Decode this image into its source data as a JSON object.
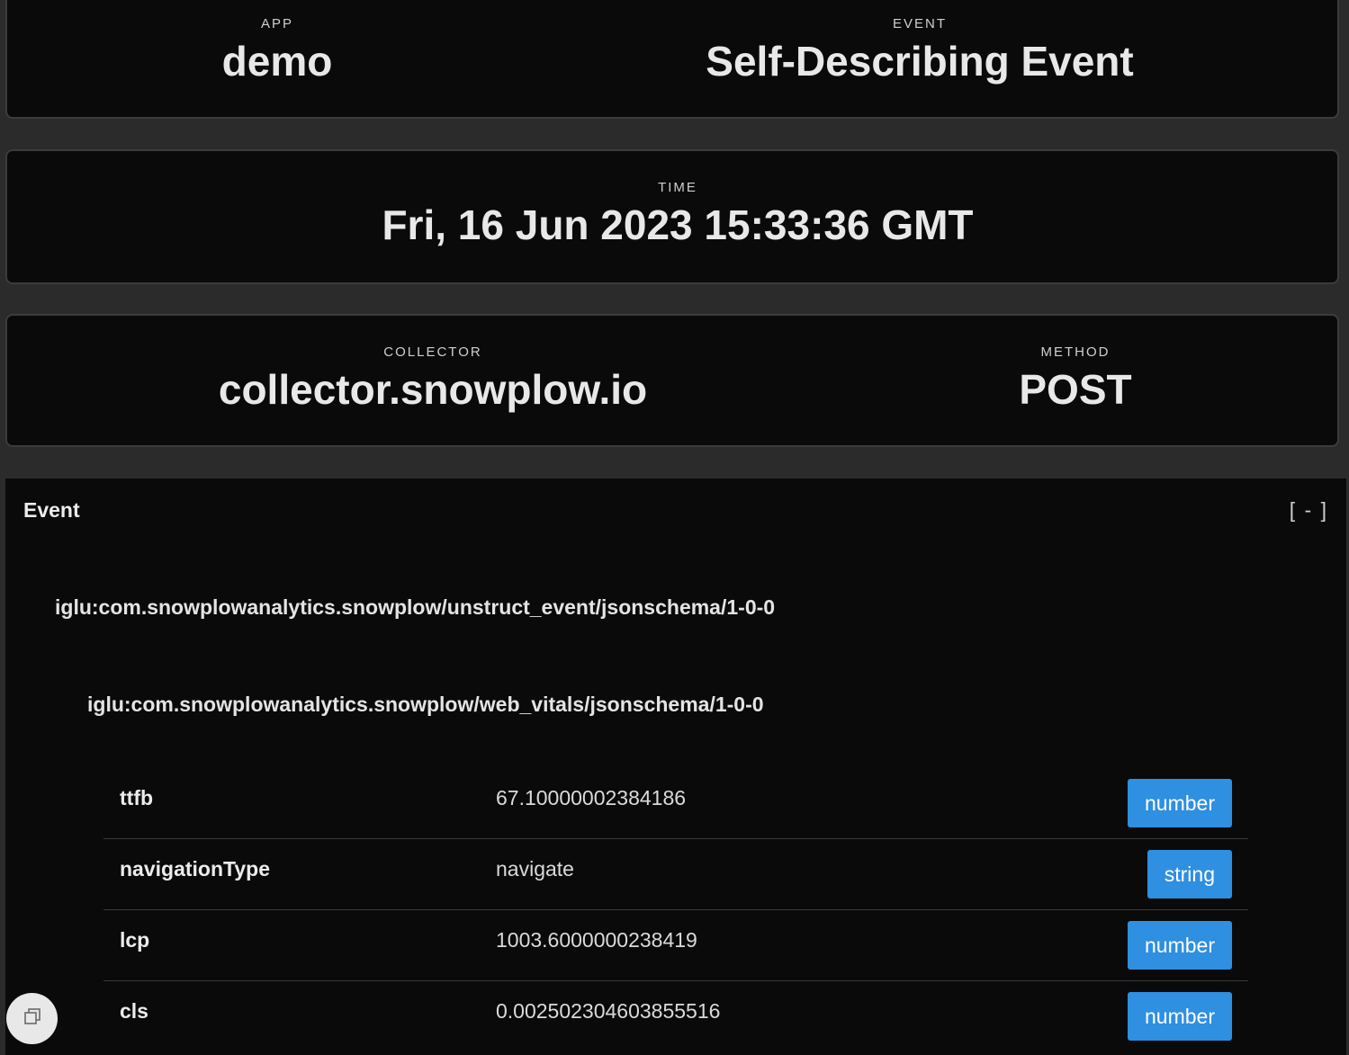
{
  "summary": {
    "app": {
      "label": "APP",
      "value": "demo"
    },
    "event": {
      "label": "EVENT",
      "value": "Self-Describing Event"
    },
    "time": {
      "label": "TIME",
      "value": "Fri, 16 Jun 2023 15:33:36 GMT"
    },
    "collector": {
      "label": "COLLECTOR",
      "value": "collector.snowplow.io"
    },
    "method": {
      "label": "METHOD",
      "value": "POST"
    }
  },
  "event_panel": {
    "title": "Event",
    "toggle": "[ - ]",
    "outer_schema": "iglu:com.snowplowanalytics.snowplow/unstruct_event/jsonschema/1-0-0",
    "inner_schema": "iglu:com.snowplowanalytics.snowplow/web_vitals/jsonschema/1-0-0",
    "properties": [
      {
        "key": "ttfb",
        "value": "67.10000002384186",
        "type": "number"
      },
      {
        "key": "navigationType",
        "value": "navigate",
        "type": "string"
      },
      {
        "key": "lcp",
        "value": "1003.6000000238419",
        "type": "number"
      },
      {
        "key": "cls",
        "value": "0.002502304603855516",
        "type": "number"
      }
    ]
  },
  "colors": {
    "badge": "#2f8fe0",
    "panel_bg": "#0a0a0a",
    "page_bg": "#2b2b2b"
  },
  "fab_icon": "copy-icon"
}
